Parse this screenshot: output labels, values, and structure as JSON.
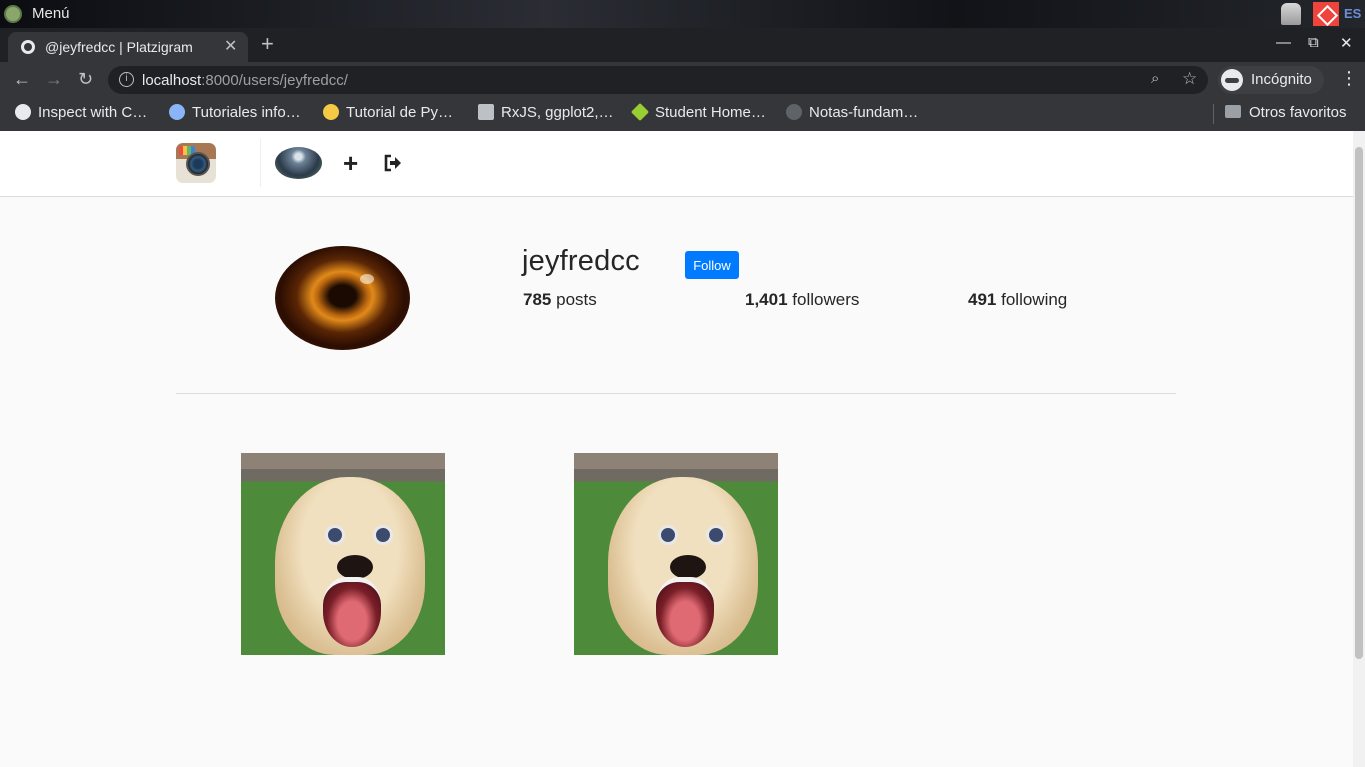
{
  "os": {
    "menu_label": "Menú",
    "lang": "ES"
  },
  "browser": {
    "tab_title": "@jeyfredcc | Platzigram",
    "tab_close": "✕",
    "new_tab": "+",
    "url_host": "localhost",
    "url_rest": ":8000/users/jeyfredcc/",
    "incognito_label": "Incógnito",
    "bookmarks": [
      {
        "label": "Inspect with C…",
        "color": "#e8eaed"
      },
      {
        "label": "Tutoriales info…",
        "color": "#8ab4f8"
      },
      {
        "label": "Tutorial de Py…",
        "color": "#f6c945"
      },
      {
        "label": "RxJS, ggplot2,…",
        "color": "#bdc1c6"
      },
      {
        "label": "Student Home…",
        "color": "#9acd32"
      },
      {
        "label": "Notas-fundam…",
        "color": "#5f6368"
      }
    ],
    "other_bookmarks": "Otros favoritos"
  },
  "profile": {
    "username": "jeyfredcc",
    "follow_label": "Follow",
    "posts_count": "785",
    "posts_label": "posts",
    "followers_count": "1,401",
    "followers_label": "followers",
    "following_count": "491",
    "following_label": "following"
  }
}
